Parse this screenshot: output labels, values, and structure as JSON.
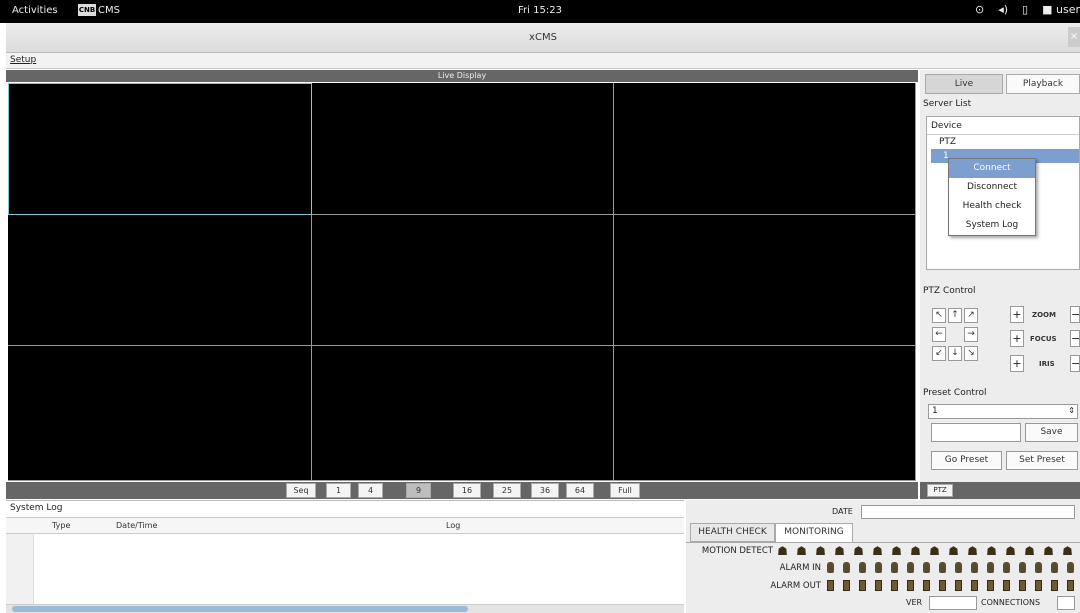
{
  "topbar": {
    "activities": "Activities",
    "app_logo": "CNB",
    "app_name": "CMS",
    "clock": "Fri 15:23",
    "user": "user"
  },
  "window": {
    "title": "xCMS",
    "close_label": "×"
  },
  "menubar": {
    "setup": "Setup"
  },
  "live_display": {
    "header": "Live Display",
    "selected_cell": 0,
    "layout_buttons": [
      "Seq",
      "1",
      "4",
      "9",
      "16",
      "25",
      "36",
      "64",
      "Full"
    ],
    "active_layout": "9"
  },
  "right_panel": {
    "tabs": [
      "Live",
      "Playback"
    ],
    "active_tab": "Live",
    "server_list_label": "Server List",
    "device_header": "Device",
    "devices": [
      "PTZ",
      "1"
    ],
    "context_menu": [
      "Connect",
      "Disconnect",
      "Health check",
      "System Log"
    ],
    "context_menu_highlight": "Connect",
    "ptz_label": "PTZ Control",
    "ptz_arrows": [
      "↖",
      "↑",
      "↗",
      "←",
      "",
      "→",
      "↙",
      "↓",
      "↘"
    ],
    "plus": "+",
    "minus": "−",
    "zoom": "ZOOM",
    "focus": "FOCUS",
    "iris": "IRIS",
    "preset_label": "Preset Control",
    "preset_value": "1",
    "save": "Save",
    "go_preset": "Go Preset",
    "set_preset": "Set Preset",
    "ptz_bar_button": "PTZ"
  },
  "system_log": {
    "title": "System Log",
    "columns": [
      "Type",
      "Date/Time",
      "Log"
    ]
  },
  "monitor": {
    "date_label": "DATE",
    "tabs": [
      "HEALTH CHECK",
      "MONITORING"
    ],
    "active_tab": "MONITORING",
    "rows": [
      "MOTION DETECT",
      "ALARM IN",
      "ALARM OUT"
    ],
    "channels": 16,
    "ver_label": "VER",
    "connections_label": "CONNECTIONS",
    "colors": {
      "alarm_icon": "#5a4a2e",
      "motion_icon": "#3b2f17"
    }
  }
}
